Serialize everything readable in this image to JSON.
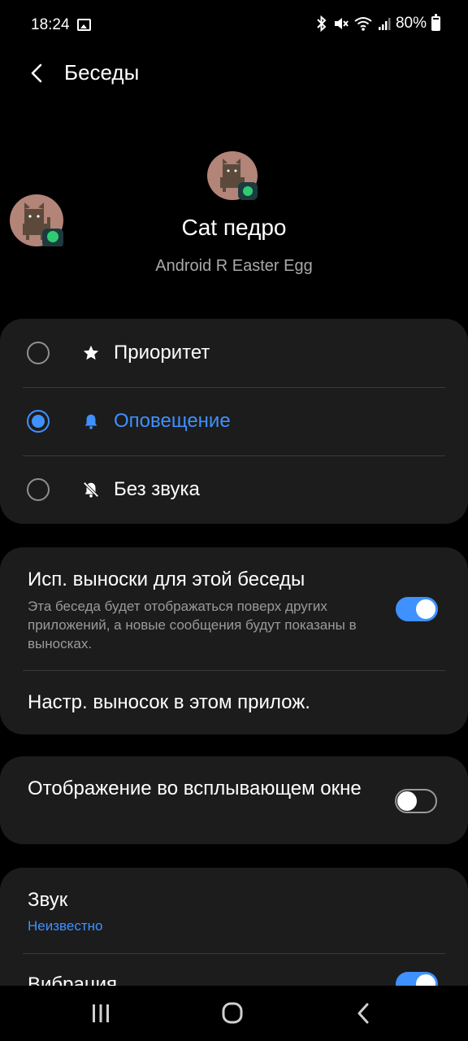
{
  "status_bar": {
    "time": "18:24",
    "battery": "80%",
    "icons": [
      "image-icon",
      "bluetooth-icon",
      "mute-icon",
      "wifi-icon",
      "signal-icon",
      "battery-icon"
    ]
  },
  "header": {
    "title": "Беседы",
    "back_icon": "back-arrow-icon"
  },
  "conversation": {
    "name": "Cat педро",
    "app": "Android R Easter Egg"
  },
  "priority_options": [
    {
      "label": "Приоритет",
      "icon": "star-icon",
      "selected": false
    },
    {
      "label": "Оповещение",
      "icon": "bell-icon",
      "selected": true
    },
    {
      "label": "Без звука",
      "icon": "bell-off-icon",
      "selected": false
    }
  ],
  "bubbles": {
    "title": "Исп. выноски для этой беседы",
    "description": "Эта беседа будет отображаться поверх других приложений, а новые сообщения будут показаны в выносках.",
    "enabled": true,
    "settings_link": "Настр. выносок в этом прилож."
  },
  "popup": {
    "title": "Отображение во всплывающем окне",
    "enabled": false
  },
  "sound": {
    "title": "Звук",
    "value": "Неизвестно"
  },
  "vibration": {
    "title": "Вибрация",
    "enabled": true
  },
  "colors": {
    "accent": "#3e91ff",
    "card": "#1c1c1c",
    "background": "#000000"
  }
}
